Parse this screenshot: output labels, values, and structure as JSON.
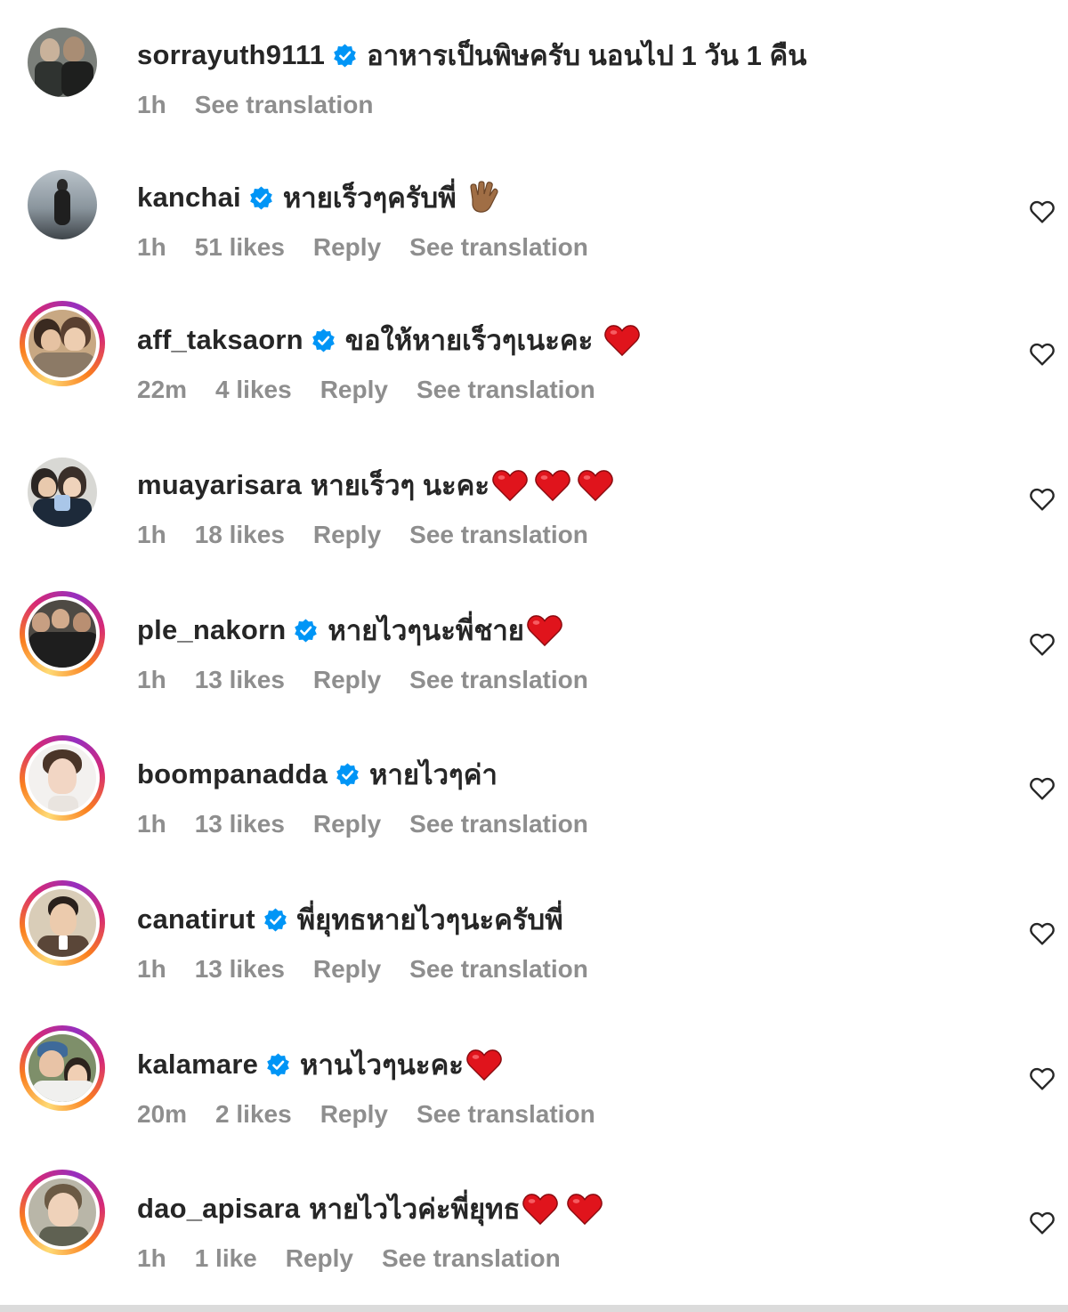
{
  "comments": [
    {
      "username": "sorrayuth9111",
      "verified": true,
      "text": "อาหารเป็นพิษครับ นอนไป 1 วัน 1 คืน",
      "emojis": [],
      "time": "1h",
      "likes": "",
      "reply": "",
      "see_translation": "See translation",
      "has_like_button": false,
      "story_ring": false
    },
    {
      "username": "kanchai",
      "verified": true,
      "text": "หายเร็วๆครับพี่",
      "emojis": [
        "vulcan-salute"
      ],
      "time": "1h",
      "likes": "51 likes",
      "reply": "Reply",
      "see_translation": "See translation",
      "has_like_button": true,
      "story_ring": false
    },
    {
      "username": "aff_taksaorn",
      "verified": true,
      "text": "ขอให้หายเร็วๆเนะคะ",
      "emojis": [
        "red-heart"
      ],
      "time": "22m",
      "likes": "4 likes",
      "reply": "Reply",
      "see_translation": "See translation",
      "has_like_button": true,
      "story_ring": true
    },
    {
      "username": "muayarisara",
      "verified": false,
      "text": "หายเร็วๆ นะคะ",
      "emojis": [
        "red-heart",
        "red-heart",
        "red-heart"
      ],
      "time": "1h",
      "likes": "18 likes",
      "reply": "Reply",
      "see_translation": "See translation",
      "has_like_button": true,
      "story_ring": false
    },
    {
      "username": "ple_nakorn",
      "verified": true,
      "text": "หายไวๆนะพี่ชาย",
      "emojis": [
        "red-heart"
      ],
      "time": "1h",
      "likes": "13 likes",
      "reply": "Reply",
      "see_translation": "See translation",
      "has_like_button": true,
      "story_ring": true
    },
    {
      "username": "boompanadda",
      "verified": true,
      "text": "หายไวๆค่า",
      "emojis": [],
      "time": "1h",
      "likes": "13 likes",
      "reply": "Reply",
      "see_translation": "See translation",
      "has_like_button": true,
      "story_ring": true
    },
    {
      "username": "canatirut",
      "verified": true,
      "text": "พี่ยุทธหายไวๆนะครับพี่",
      "emojis": [],
      "time": "1h",
      "likes": "13 likes",
      "reply": "Reply",
      "see_translation": "See translation",
      "has_like_button": true,
      "story_ring": true
    },
    {
      "username": "kalamare",
      "verified": true,
      "text": "หานไวๆนะคะ",
      "emojis": [
        "red-heart"
      ],
      "time": "20m",
      "likes": "2 likes",
      "reply": "Reply",
      "see_translation": "See translation",
      "has_like_button": true,
      "story_ring": true
    },
    {
      "username": "dao_apisara",
      "verified": false,
      "text": "หายไวไวค่ะพี่ยุทธ",
      "emojis": [
        "red-heart",
        "red-heart"
      ],
      "time": "1h",
      "likes": "1 like",
      "reply": "Reply",
      "see_translation": "See translation",
      "has_like_button": true,
      "story_ring": true
    }
  ],
  "colors": {
    "username": "#262626",
    "meta_gray": "#8e8e8e",
    "verified_blue": "#0095f6",
    "heart_red": "#e0141c"
  },
  "icons": {
    "verified": "verified-badge-icon",
    "like": "heart-outline-icon"
  }
}
